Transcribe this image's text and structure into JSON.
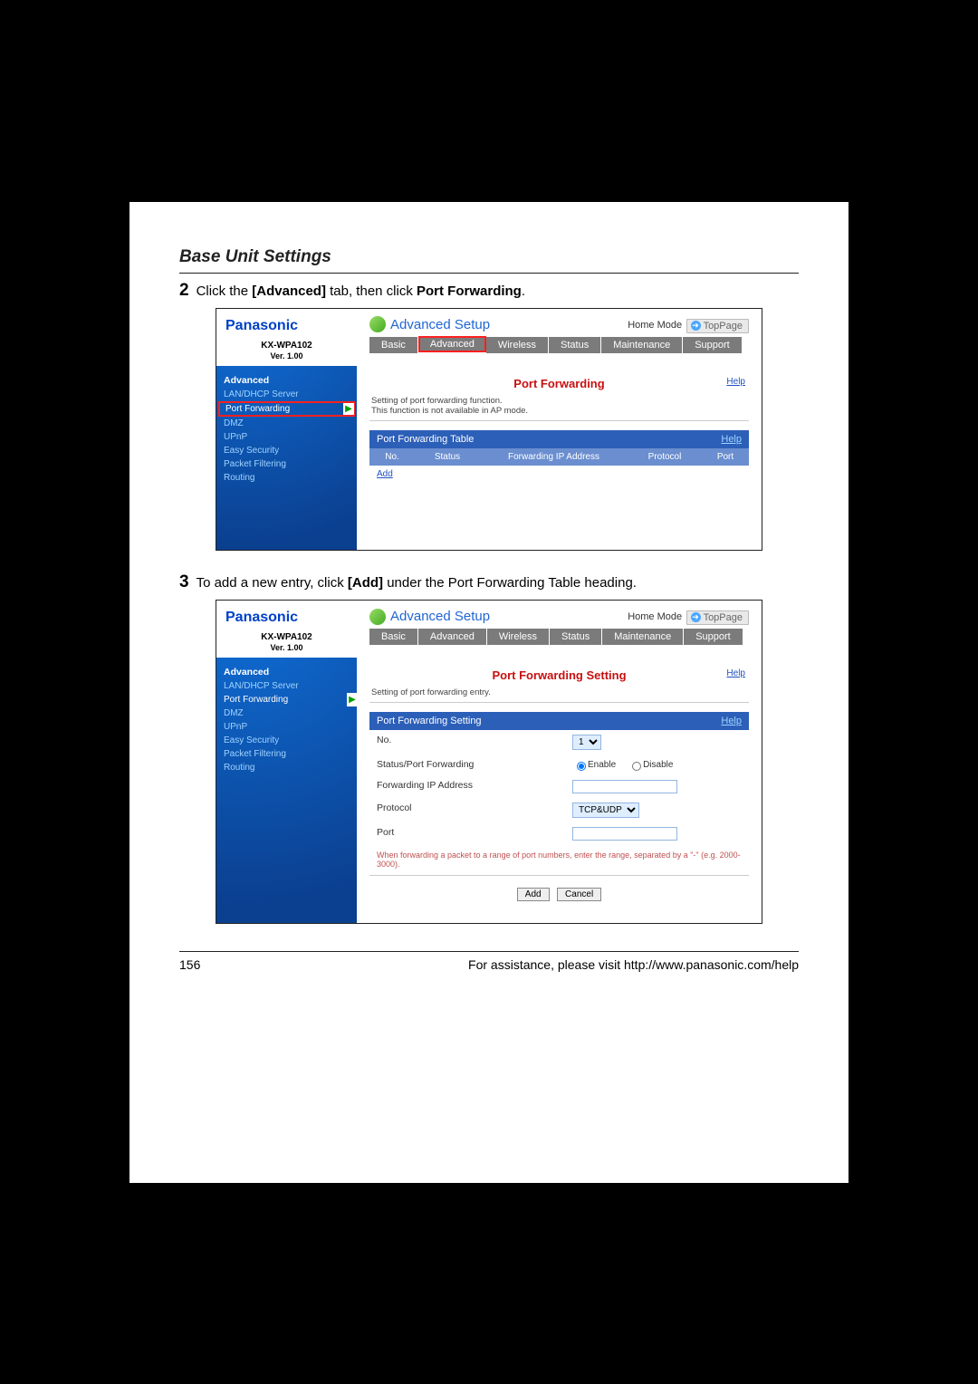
{
  "section_title": "Base Unit Settings",
  "steps": {
    "s2": {
      "num": "2",
      "pre": "Click the ",
      "b1": "[Advanced]",
      "mid": " tab, then click ",
      "b2": "Port Forwarding",
      "post": "."
    },
    "s3": {
      "num": "3",
      "pre": "To add a new entry, click ",
      "b1": "[Add]",
      "post": " under the Port Forwarding Table heading."
    }
  },
  "shot_common": {
    "brand": "Panasonic",
    "model": "KX-WPA102",
    "version": "Ver. 1.00",
    "adv_setup": "Advanced Setup",
    "home_mode": "Home Mode",
    "top_page": "TopPage",
    "tabs": {
      "basic": "Basic",
      "advanced": "Advanced",
      "wireless": "Wireless",
      "status": "Status",
      "maintenance": "Maintenance",
      "support": "Support"
    },
    "sidebar": {
      "head": "Advanced",
      "items": [
        "LAN/DHCP Server",
        "Port Forwarding",
        "DMZ",
        "UPnP",
        "Easy Security",
        "Packet Filtering",
        "Routing"
      ]
    },
    "help": "Help"
  },
  "shot1": {
    "title": "Port Forwarding",
    "note1": "Setting of port forwarding function.",
    "note2": "This function is not available in AP mode.",
    "table_header": "Port Forwarding Table",
    "cols": {
      "no": "No.",
      "status": "Status",
      "ip": "Forwarding IP Address",
      "proto": "Protocol",
      "port": "Port"
    },
    "add": "Add"
  },
  "shot2": {
    "title": "Port Forwarding Setting",
    "note": "Setting of port forwarding entry.",
    "table_header": "Port Forwarding Setting",
    "rows": {
      "no": "No.",
      "status": "Status/Port Forwarding",
      "ip": "Forwarding IP Address",
      "proto": "Protocol",
      "port": "Port"
    },
    "no_value": "1",
    "enable": "Enable",
    "disable": "Disable",
    "proto_value": "TCP&UDP",
    "hint": "When forwarding a packet to a range of port numbers, enter the range, separated by a \"-\" (e.g. 2000-3000).",
    "btn_add": "Add",
    "btn_cancel": "Cancel"
  },
  "footer": {
    "page": "156",
    "text": "For assistance, please visit http://www.panasonic.com/help"
  }
}
